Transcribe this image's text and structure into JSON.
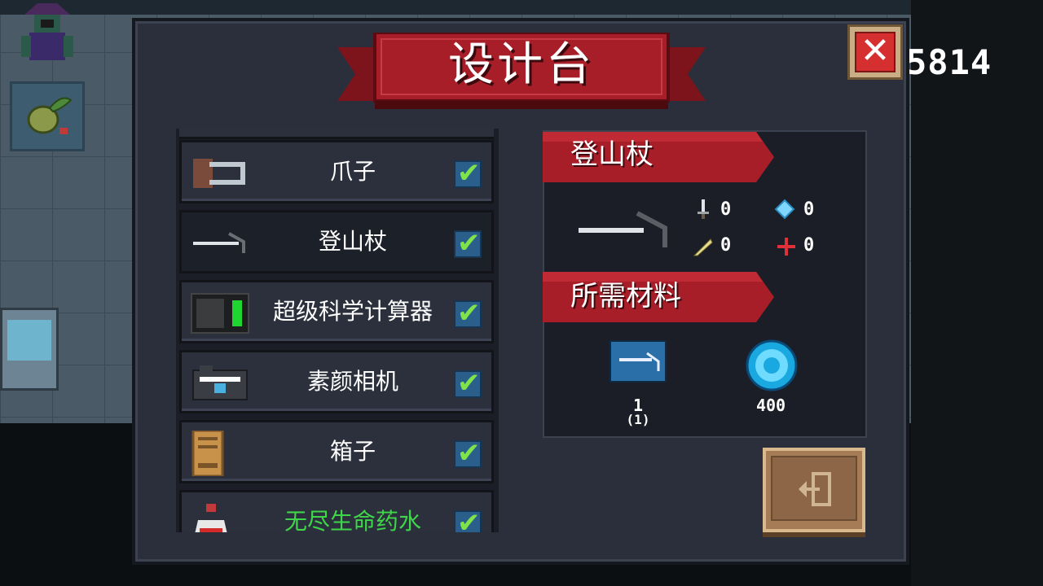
{
  "background": {
    "score_text": "5814"
  },
  "dialog": {
    "title": "设计台",
    "close_label": "✕"
  },
  "recipe_list": {
    "items": [
      {
        "label": "爪子",
        "icon": "claw-icon",
        "checked": true,
        "color": "#ffffff"
      },
      {
        "label": "登山杖",
        "icon": "climbing-stick-icon",
        "checked": true,
        "color": "#ffffff",
        "selected": true
      },
      {
        "label": "超级科学计算器",
        "icon": "calculator-icon",
        "checked": true,
        "color": "#ffffff"
      },
      {
        "label": "素颜相机",
        "icon": "camera-icon",
        "checked": true,
        "color": "#ffffff"
      },
      {
        "label": "箱子",
        "icon": "box-icon",
        "checked": true,
        "color": "#ffffff"
      },
      {
        "label": "无尽生命药水",
        "icon": "potion-icon",
        "checked": true,
        "color": "#3fd64a"
      }
    ]
  },
  "detail": {
    "item_name": "登山杖",
    "stats": {
      "attack": "0",
      "energy": "0",
      "crit": "0",
      "accuracy": "0"
    },
    "materials_title": "所需材料",
    "materials": [
      {
        "icon": "blueprint-icon",
        "count_top": "1",
        "count_bottom": "(1)"
      },
      {
        "icon": "gem-icon",
        "count": "400"
      }
    ],
    "exit_icon": "exit-icon"
  },
  "colors": {
    "ribbon": "#9e1c24",
    "panel": "#2a2f3b",
    "check": "#7fe34a",
    "green_text": "#3fd64a"
  }
}
